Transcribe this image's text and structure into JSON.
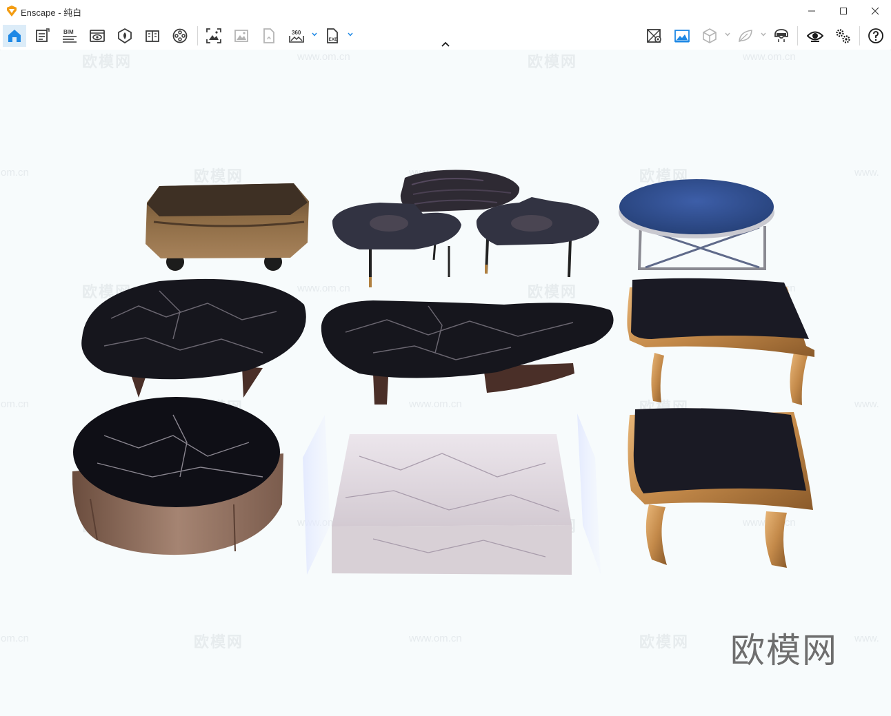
{
  "window": {
    "app_name": "Enscape",
    "title_separator": " - ",
    "scene_name": "纯白",
    "minimize_label": "Minimize",
    "maximize_label": "Maximize",
    "close_label": "Close"
  },
  "toolbar": {
    "bim_label": "BIM",
    "pano_label": "360",
    "exe_label": "EXE"
  },
  "watermark": {
    "brand": "欧模网",
    "url": "www.om.cn",
    "url_partial_left": "om.cn",
    "url_partial_right": "www."
  },
  "colors": {
    "accent": "#1e88e5",
    "icon": "#3a3a3a",
    "icon_disabled": "#b4b4b4",
    "active_bg": "#dcecf8"
  }
}
